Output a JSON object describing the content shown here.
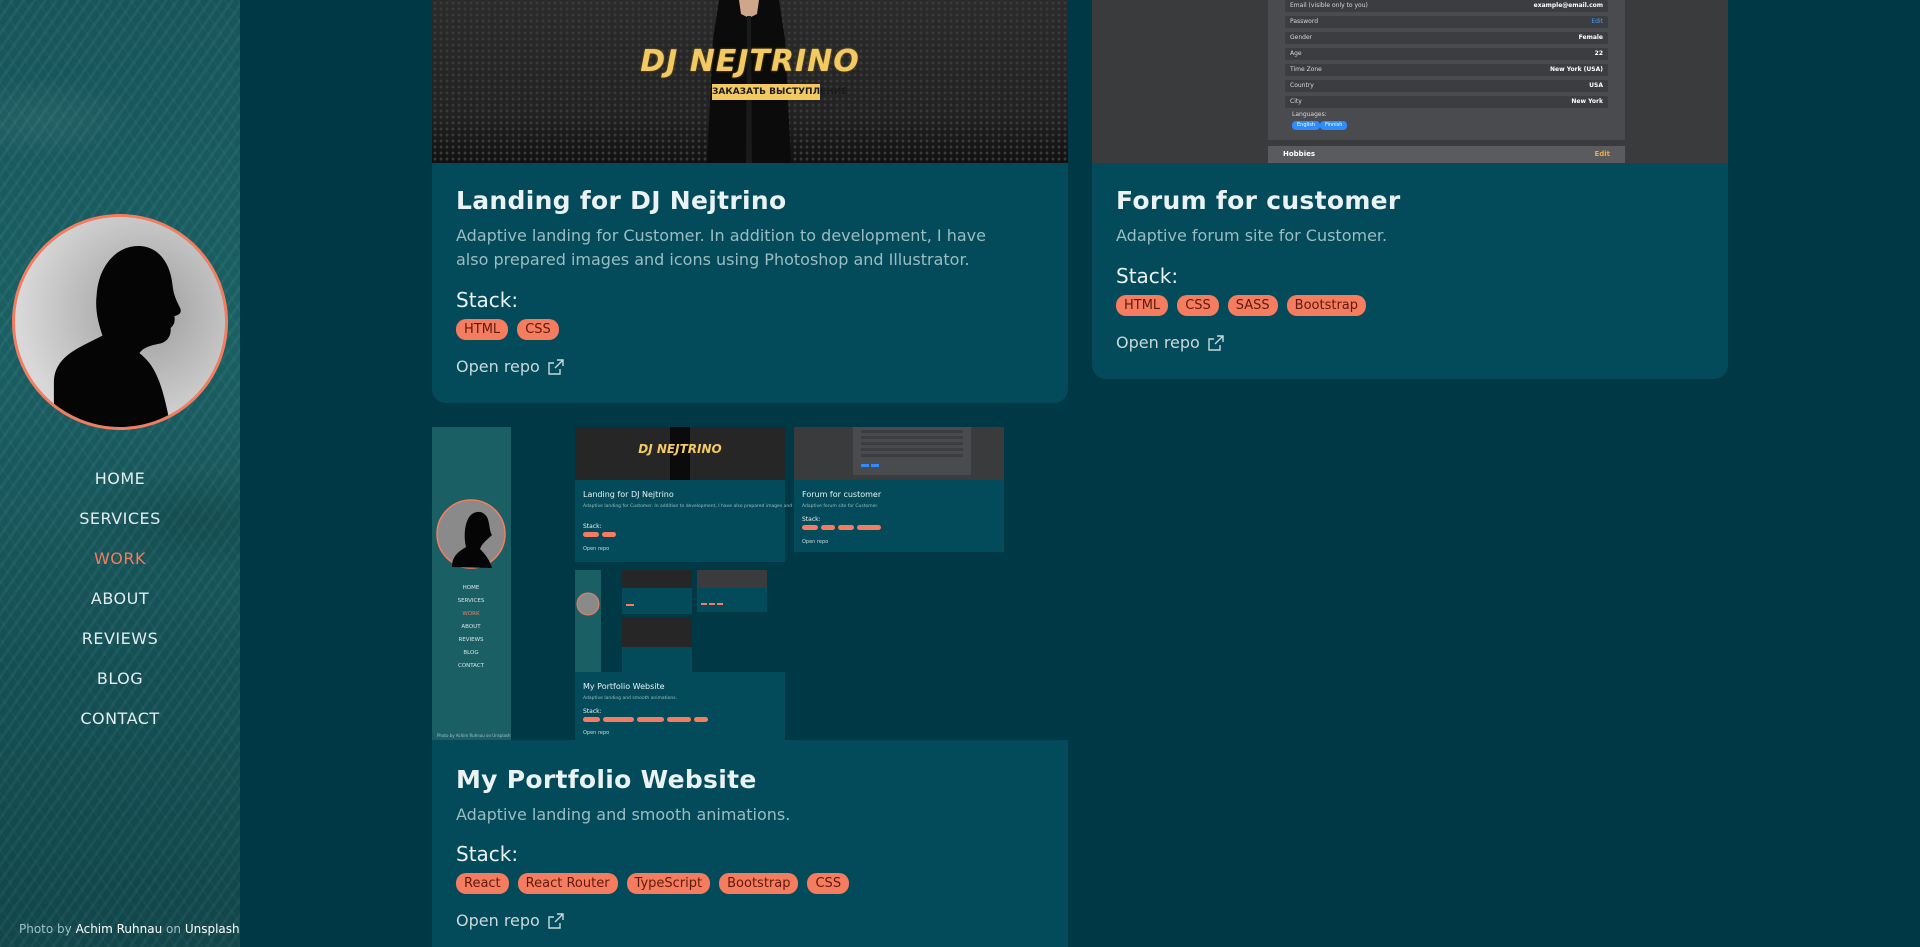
{
  "sidebar": {
    "nav": [
      "HOME",
      "SERVICES",
      "WORK",
      "ABOUT",
      "REVIEWS",
      "BLOG",
      "CONTACT"
    ],
    "active_index": 2,
    "credit": {
      "prefix": "Photo by",
      "author": "Achim Ruhnau",
      "on": "on",
      "source": "Unsplash"
    }
  },
  "colors": {
    "accent": "#f57c5f",
    "background": "#003945",
    "card": "#034b5a"
  },
  "projects": [
    {
      "title": "Landing for DJ Nejtrino",
      "description": "Adaptive landing for Customer. In addition to development, I have also prepared images and icons using Photoshop and Illustrator.",
      "stack_label": "Stack:",
      "tags": [
        "HTML",
        "CSS"
      ],
      "repo_label": "Open repo",
      "preview": {
        "logo": "DJ NEJTRINO",
        "button": "ЗАКАЗАТЬ ВЫСТУПЛЕНИЕ"
      }
    },
    {
      "title": "Forum for customer",
      "description": "Adaptive forum site for Customer.",
      "stack_label": "Stack:",
      "tags": [
        "HTML",
        "CSS",
        "SASS",
        "Bootstrap"
      ],
      "repo_label": "Open repo",
      "preview": {
        "rows": [
          {
            "label": "Email (visible only to you)",
            "value": "example@email.com"
          },
          {
            "label": "Password",
            "value": "Edit"
          },
          {
            "label": "Gender",
            "value": "Female"
          },
          {
            "label": "Age",
            "value": "22"
          },
          {
            "label": "Time Zone",
            "value": "New York (USA)"
          },
          {
            "label": "Country",
            "value": "USA"
          },
          {
            "label": "City",
            "value": "New York"
          }
        ],
        "languages_label": "Languages:",
        "languages": [
          "English",
          "Finnish"
        ],
        "hobbies_label": "Hobbies",
        "hobbies_edit": "Edit"
      }
    },
    {
      "title": "My Portfolio Website",
      "description": "Adaptive landing and smooth animations.",
      "stack_label": "Stack:",
      "tags": [
        "React",
        "React Router",
        "TypeScript",
        "Bootstrap",
        "CSS"
      ],
      "repo_label": "Open repo",
      "preview": {
        "nav": [
          "HOME",
          "SERVICES",
          "WORK",
          "ABOUT",
          "REVIEWS",
          "BLOG",
          "CONTACT"
        ],
        "card1_title": "Landing for DJ Nejtrino",
        "card1_desc": "Adaptive landing for Customer. In addition to development, I have also prepared images and icons using Photoshop and Illustrator.",
        "card2_title": "Forum for customer",
        "card2_desc": "Adaptive forum site for Customer.",
        "card3_title": "My Portfolio Website",
        "card3_desc": "Adaptive landing and smooth animations.",
        "stack": "Stack:",
        "repo": "Open repo",
        "logo": "DJ NEJTRINO",
        "credit": "Photo by Achim Ruhnau on Unsplash"
      }
    }
  ]
}
